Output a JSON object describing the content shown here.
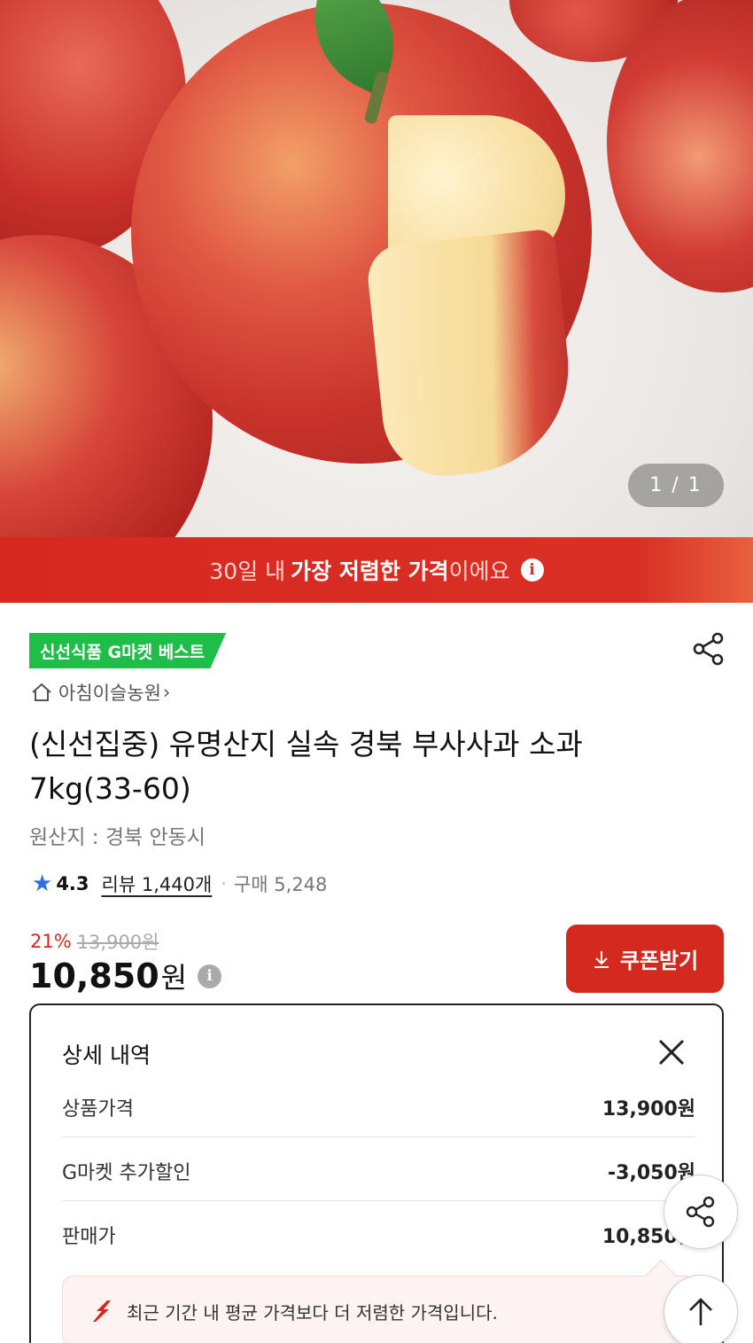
{
  "hero": {
    "image_desc": "red apples with cut slice",
    "counter": "1 / 1"
  },
  "banner": {
    "prefix": "30일 내",
    "highlight": "가장 저렴한 가격",
    "suffix": "이에요",
    "info_icon": "i"
  },
  "product": {
    "badge": "신선식품 G마켓 베스트",
    "shop_name": "아침이슬농원",
    "shop_chevron": "›",
    "title": "(신선집중) 유명산지 실속 경북 부사사과 소과 7kg(33-60)",
    "origin": "원산지 : 경북 안동시",
    "rating": "4.3",
    "reviews": "리뷰 1,440개",
    "separator": "·",
    "purchases": "구매 5,248",
    "discount_pct": "21%",
    "original_price": "13,900원",
    "price_number": "10,850",
    "price_unit": "원",
    "price_info_icon": "i",
    "coupon_label": "쿠폰받기"
  },
  "detail_panel": {
    "title": "상세 내역",
    "rows": [
      {
        "label": "상품가격",
        "value": "13,900원"
      },
      {
        "label": "G마켓 추가할인",
        "value": "-3,050원"
      },
      {
        "label": "판매가",
        "value": "10,850원"
      }
    ],
    "tip": "최근 기간 내 평균 가격보다 더 저렴한 가격입니다."
  },
  "colors": {
    "brand_red": "#d7281f",
    "badge_green": "#1fbe49",
    "star_blue": "#2d6fe6"
  },
  "icons": [
    "share-icon",
    "home-icon",
    "star-icon",
    "info-icon",
    "download-arrow-icon",
    "close-icon",
    "trend-down-icon",
    "arrow-up-icon"
  ]
}
